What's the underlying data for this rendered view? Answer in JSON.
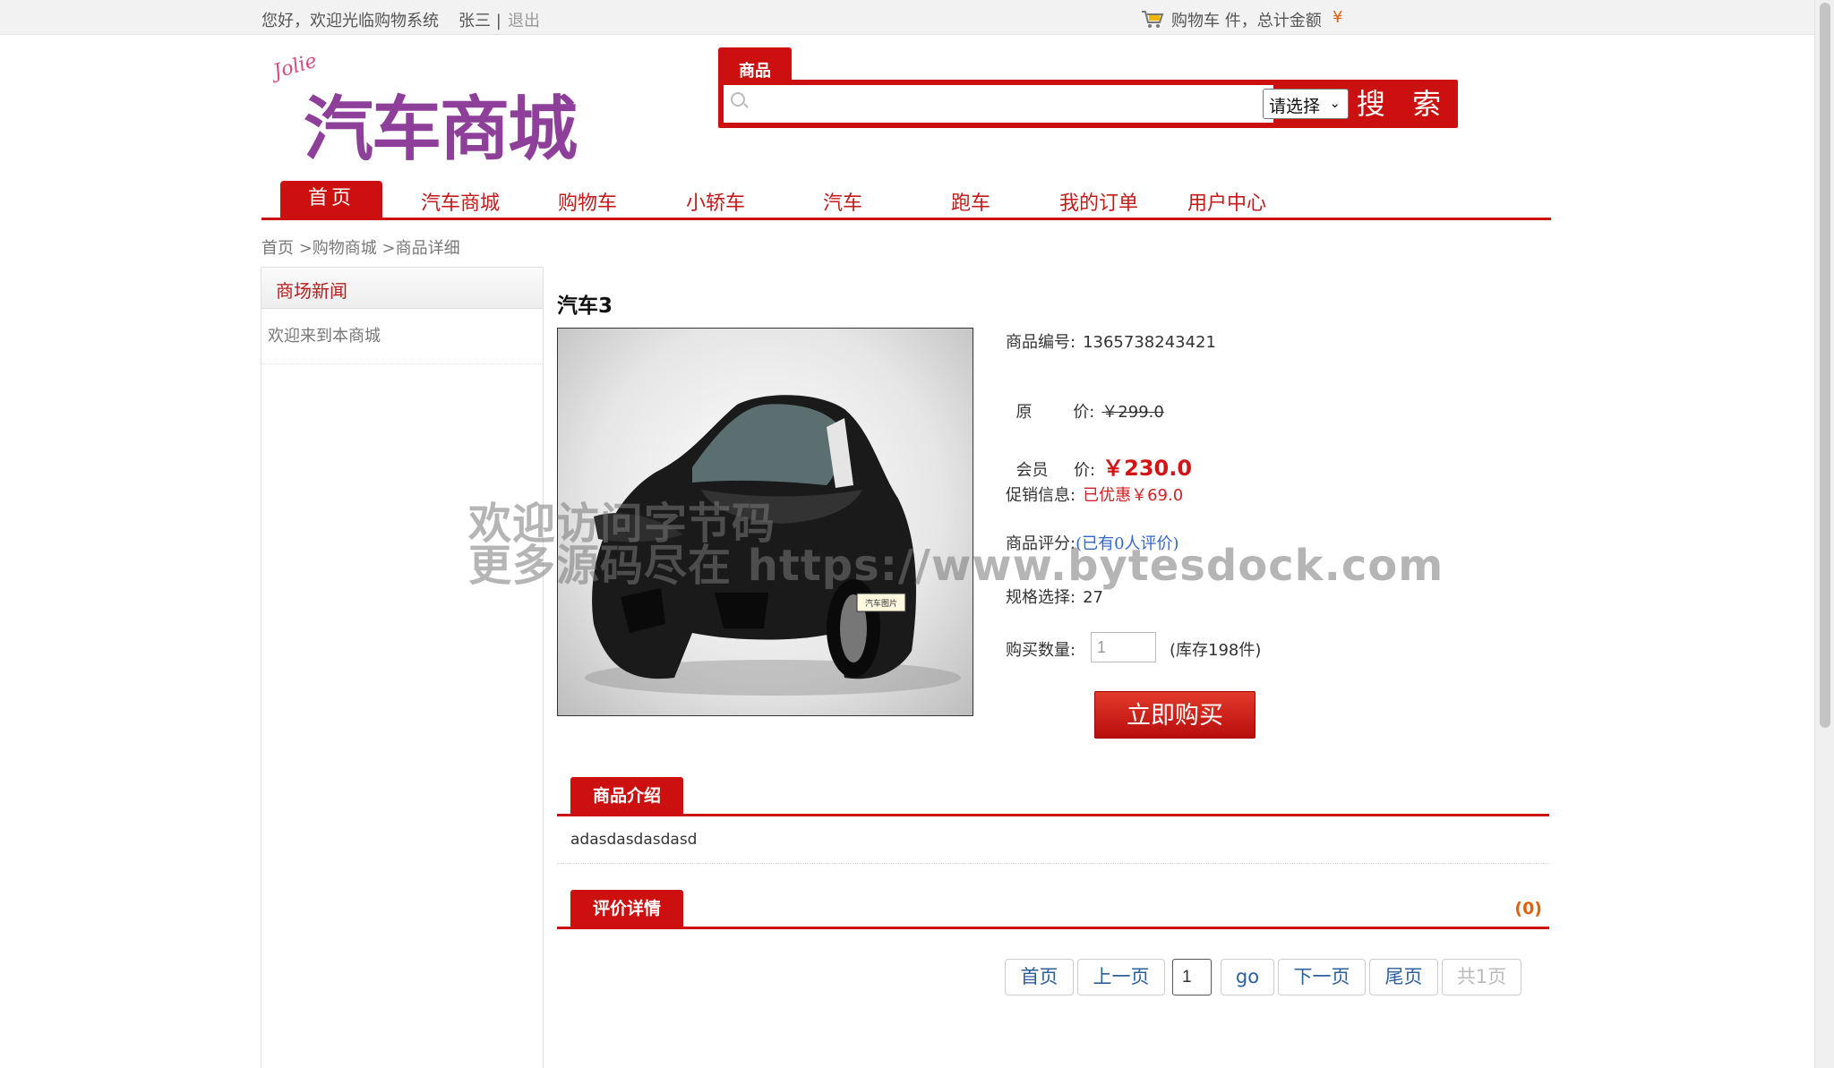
{
  "topbar": {
    "welcome": "您好，欢迎光临购物系统",
    "user": "张三 |",
    "logout": "退出",
    "cart_text": "购物车 件，总计金额",
    "cart_currency": "¥"
  },
  "logo": {
    "title": "汽车商城",
    "subtitle": "Jolie"
  },
  "search": {
    "tab_label": "商品",
    "placeholder": "",
    "select_value": "请选择",
    "button_label": "搜 索"
  },
  "nav": {
    "active": "首页",
    "items": [
      "汽车商城",
      "购物车",
      "小轿车",
      "汽车",
      "跑车",
      "我的订单",
      "用户中心"
    ]
  },
  "breadcrumb": "首页 >购物商城 >商品详细",
  "sidebar": {
    "title": "商场新闻",
    "news": "欢迎来到本商城"
  },
  "product": {
    "title": "汽车3",
    "image_caption": "汽车图片",
    "code_label": "商品编号:",
    "code": "1365738243421",
    "orig_price_label": "原        价:",
    "orig_price": "￥299.0",
    "member_price_label": "会员     价:",
    "member_price": "￥230.0",
    "promo_label": "促销信息:",
    "promo": "已优惠￥69.0",
    "rating_label": "商品评分:",
    "rating": "(已有0人评价)",
    "spec_label": "规格选择:",
    "spec": "27",
    "qty_label": "购买数量:",
    "qty_value": "1",
    "stock": "(库存198件)",
    "buy_button": "立即购买"
  },
  "intro": {
    "tab": "商品介绍",
    "text": "adasdasdasdasd"
  },
  "reviews": {
    "tab": "评价详情",
    "count": "(0)"
  },
  "pagination": {
    "first": "首页",
    "prev": "上一页",
    "page_value": "1",
    "go": "go",
    "next": "下一页",
    "last": "尾页",
    "total": "共1页"
  },
  "watermark": {
    "line1": "欢迎访问字节码",
    "line2": "更多源码尽在  https://www.bytesdock.com"
  },
  "colors": {
    "brand_red": "#cc1010",
    "price_red": "#d41414",
    "accent_orange": "#e0610c",
    "link_blue": "#3366cc"
  }
}
